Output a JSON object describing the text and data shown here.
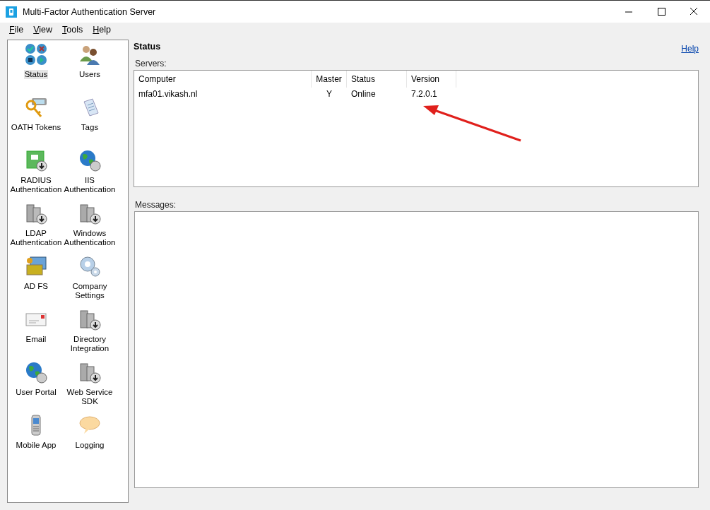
{
  "window": {
    "title": "Multi-Factor Authentication Server"
  },
  "menu": [
    "File",
    "View",
    "Tools",
    "Help"
  ],
  "sidebar": {
    "items": [
      {
        "label": "Status",
        "selected": true
      },
      {
        "label": "Users",
        "selected": false
      },
      {
        "label": "OATH Tokens",
        "selected": false
      },
      {
        "label": "Tags",
        "selected": false
      },
      {
        "label": "RADIUS Authentication",
        "selected": false
      },
      {
        "label": "IIS Authentication",
        "selected": false
      },
      {
        "label": "LDAP Authentication",
        "selected": false
      },
      {
        "label": "Windows Authentication",
        "selected": false
      },
      {
        "label": "AD FS",
        "selected": false
      },
      {
        "label": "Company Settings",
        "selected": false
      },
      {
        "label": "Email",
        "selected": false
      },
      {
        "label": "Directory Integration",
        "selected": false
      },
      {
        "label": "User Portal",
        "selected": false
      },
      {
        "label": "Web Service SDK",
        "selected": false
      },
      {
        "label": "Mobile App",
        "selected": false
      },
      {
        "label": "Logging",
        "selected": false
      }
    ]
  },
  "page": {
    "title": "Status",
    "help_link": "Help"
  },
  "servers": {
    "label": "Servers:",
    "columns": [
      "Computer",
      "Master",
      "Status",
      "Version"
    ],
    "rows": [
      [
        "mfa01.vikash.nl",
        "Y",
        "Online",
        "7.2.0.1"
      ]
    ]
  },
  "messages": {
    "label": "Messages:"
  }
}
